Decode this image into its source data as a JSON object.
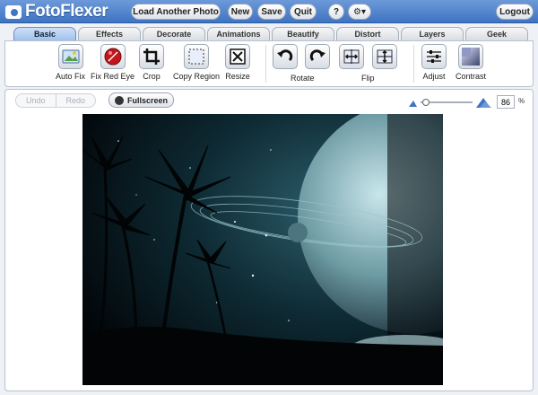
{
  "app": {
    "logo_text": "FotoFlexer",
    "buttons": {
      "load": "Load Another Photo",
      "new": "New",
      "save": "Save",
      "quit": "Quit",
      "help": "?",
      "settings": "⚙▾",
      "logout": "Logout"
    }
  },
  "tabs": [
    "Basic",
    "Effects",
    "Decorate",
    "Animations",
    "Beautify",
    "Distort",
    "Layers",
    "Geek"
  ],
  "active_tab": "Basic",
  "tools": {
    "auto_fix": "Auto Fix",
    "red_eye": "Fix Red Eye",
    "crop": "Crop",
    "copy_region": "Copy Region",
    "resize": "Resize",
    "rotate": "Rotate",
    "flip": "Flip",
    "adjust": "Adjust",
    "contrast": "Contrast"
  },
  "workspace": {
    "undo": "Undo",
    "redo": "Redo",
    "fullscreen": "Fullscreen",
    "zoom_value": "86",
    "zoom_unit": "%"
  },
  "colors": {
    "topbar": "#4a7fcc",
    "active_tab": "#9ec1ee"
  }
}
